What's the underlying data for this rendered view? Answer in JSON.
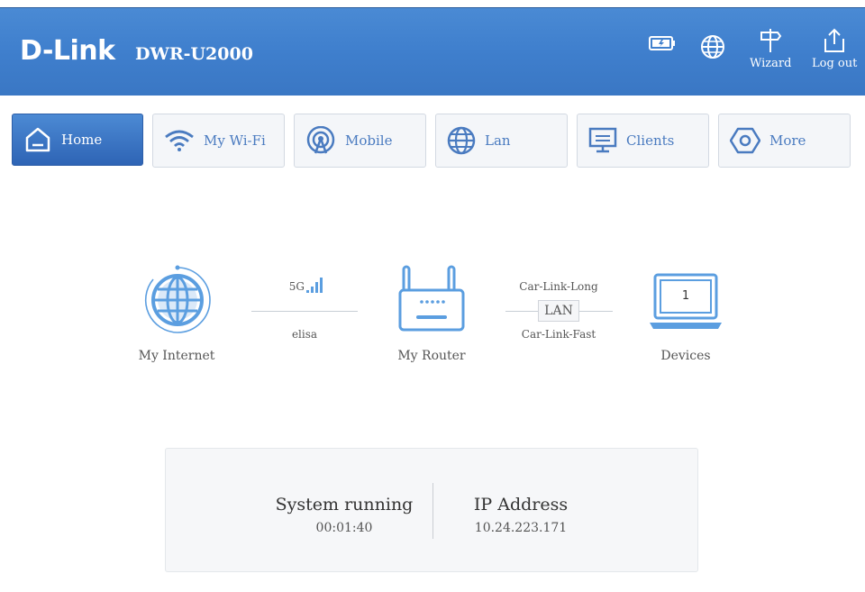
{
  "header": {
    "brand": "D-Link",
    "model": "DWR-U2000",
    "wizard_label": "Wizard",
    "logout_label": "Log out",
    "icons": [
      "battery-icon",
      "globe-icon",
      "wizard-signpost-icon",
      "logout-icon"
    ]
  },
  "nav": {
    "items": [
      {
        "label": "Home",
        "icon": "home-icon",
        "active": true
      },
      {
        "label": "My Wi-Fi",
        "icon": "wifi-icon"
      },
      {
        "label": "Mobile",
        "icon": "mobile-antenna-icon"
      },
      {
        "label": "Lan",
        "icon": "lan-globe-icon"
      },
      {
        "label": "Clients",
        "icon": "monitor-icon"
      },
      {
        "label": "More",
        "icon": "hexagon-settings-icon"
      }
    ]
  },
  "topology": {
    "internet_label": "My Internet",
    "network_type": "5G",
    "carrier": "elisa",
    "router_label": "My Router",
    "link_top": "Car-Link-Long",
    "link_box": "LAN",
    "link_bottom": "Car-Link-Fast",
    "devices_label": "Devices",
    "devices_count": "1"
  },
  "status": {
    "system_title": "System running",
    "system_value": "00:01:40",
    "ip_title": "IP Address",
    "ip_value": "10.24.223.171"
  },
  "colors": {
    "header": "#3f7fcd",
    "accent": "#4a7bc0",
    "icon_blue": "#5b9ee0"
  }
}
